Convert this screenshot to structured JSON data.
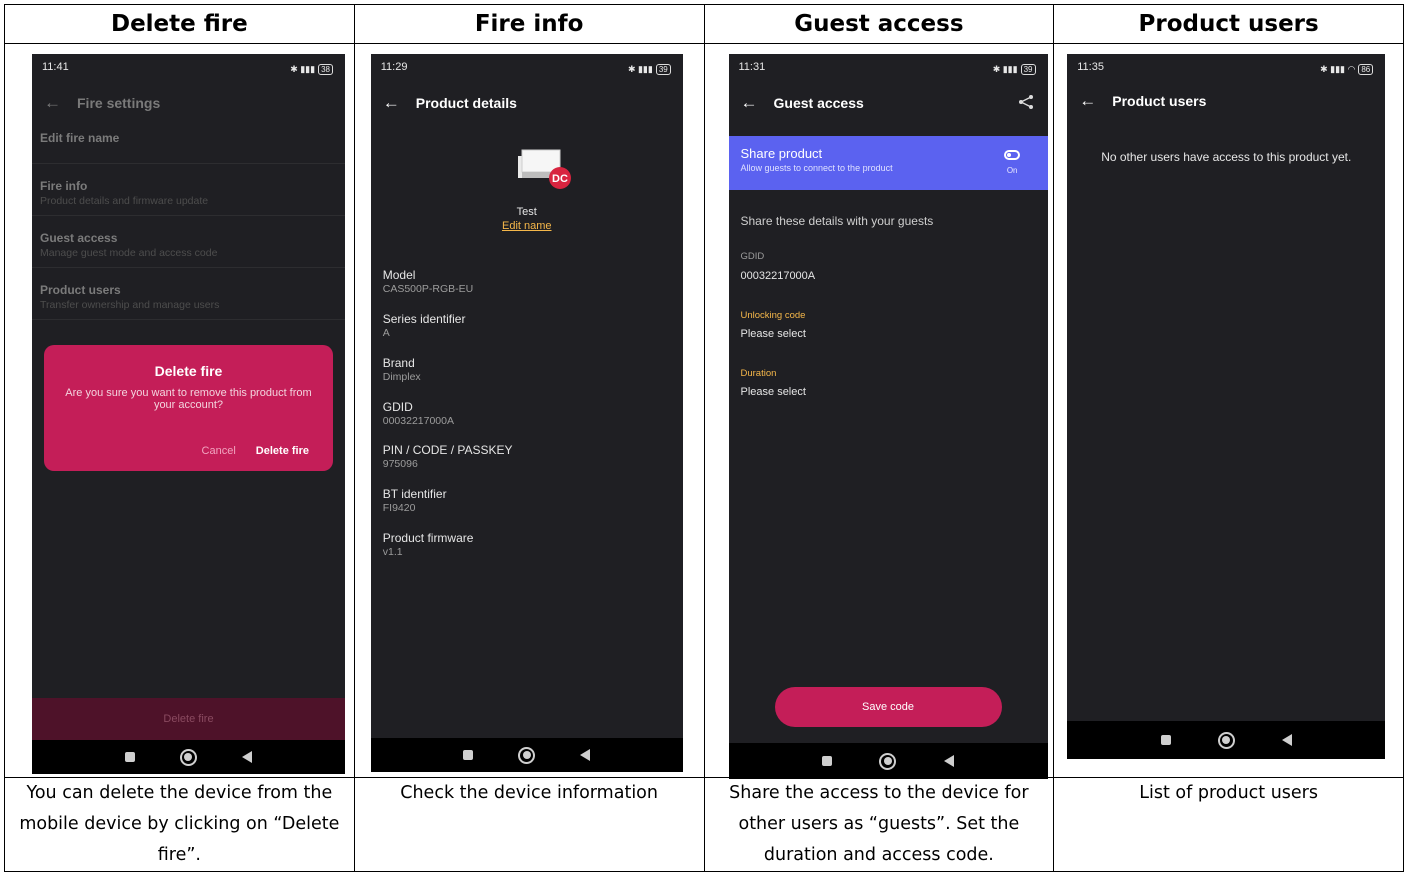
{
  "columns": [
    {
      "header": "Delete fire",
      "caption": "You can delete the device from the mobile device by clicking on “Delete fire”.",
      "phone": {
        "status_time": "11:41",
        "battery": "38",
        "title": "Fire settings",
        "menu": [
          {
            "title": "Edit fire name",
            "subtitle": ""
          },
          {
            "title": "Fire info",
            "subtitle": "Product details and firmware update"
          },
          {
            "title": "Guest access",
            "subtitle": "Manage guest mode and access code"
          },
          {
            "title": "Product users",
            "subtitle": "Transfer ownership and manage users"
          }
        ],
        "dialog": {
          "title": "Delete fire",
          "message": "Are you sure you want to remove this product from your account?",
          "cancel": "Cancel",
          "confirm": "Delete fire"
        },
        "bottom_button": "Delete fire"
      }
    },
    {
      "header": "Fire info",
      "caption": "Check the device information",
      "phone": {
        "status_time": "11:29",
        "battery": "39",
        "title": "Product details",
        "product_name": "Test",
        "edit_name": "Edit name",
        "fields": [
          {
            "key": "Model",
            "value": "CAS500P-RGB-EU"
          },
          {
            "key": "Series identifier",
            "value": "A"
          },
          {
            "key": "Brand",
            "value": "Dimplex"
          },
          {
            "key": "GDID",
            "value": "00032217000A"
          },
          {
            "key": "PIN / CODE / PASSKEY",
            "value": "975096"
          },
          {
            "key": "BT identifier",
            "value": "FI9420"
          },
          {
            "key": "Product firmware",
            "value": "v1.1"
          }
        ]
      }
    },
    {
      "header": "Guest access",
      "caption": "Share the access to the device for other users as “guests”. Set the duration and access code.",
      "phone": {
        "status_time": "11:31",
        "battery": "39",
        "title": "Guest access",
        "share_title": "Share product",
        "share_subtitle": "Allow guests to connect to the product",
        "toggle_label": "On",
        "share_heading": "Share these details with your guests",
        "gdid_label": "GDID",
        "gdid_value": "00032217000A",
        "unlock_label": "Unlocking code",
        "unlock_value": "Please select",
        "duration_label": "Duration",
        "duration_value": "Please select",
        "save_button": "Save code"
      }
    },
    {
      "header": "Product users",
      "caption": "List of product users",
      "phone": {
        "status_time": "11:35",
        "battery": "86",
        "title": "Product users",
        "empty_message": "No other users have access to this product yet."
      }
    }
  ],
  "colors": {
    "accent": "#c41e58",
    "share_banner": "#5b62f0",
    "highlight_text": "#f5b74a",
    "phone_bg": "#1f1f23"
  }
}
